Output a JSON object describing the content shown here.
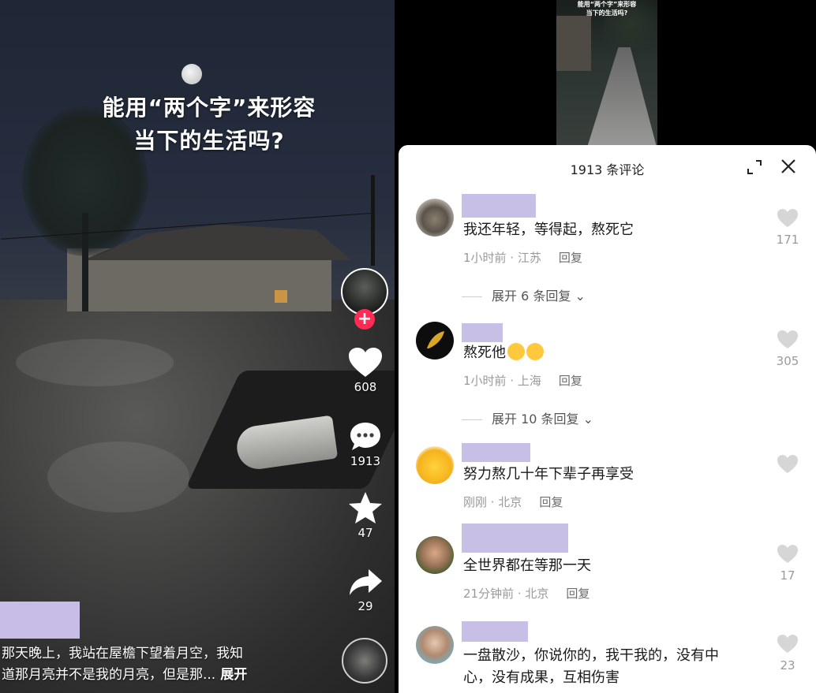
{
  "video": {
    "headline_line1": "能用“两个字”来形容",
    "headline_line2": "当下的生活吗?",
    "caption_line1": "那天晚上，我站在屋檐下望着月空，我知",
    "caption_line2": "道那月亮并不是我的月亮，但是那...",
    "caption_more": "展开",
    "actions": {
      "likes": "608",
      "comments": "1913",
      "favorites": "47",
      "shares": "29"
    },
    "follow_symbol": "+",
    "colors": {
      "follow_button": "#fe2c55"
    }
  },
  "mini_video": {
    "title_line1": "能用“两个字”来形容",
    "title_line2": "当下的生活吗?"
  },
  "comments_sheet": {
    "title": "1913 条评论",
    "colors": {
      "redacted_name": "#c8bfe6"
    },
    "comments": [
      {
        "text": "我还年轻，等得起，熬死它",
        "time": "1小时前 · 江苏",
        "reply": "回复",
        "likes": "171",
        "expand": "展开 6 条回复"
      },
      {
        "text": "熬死他",
        "time": "1小时前 · 上海",
        "reply": "回复",
        "likes": "305",
        "expand": "展开 10 条回复"
      },
      {
        "text": "努力熬几十年下辈子再享受",
        "time": "刚刚 · 北京",
        "reply": "回复",
        "likes": ""
      },
      {
        "text": "全世界都在等那一天",
        "time": "21分钟前 · 北京",
        "reply": "回复",
        "likes": "17"
      },
      {
        "text_line1": "一盘散沙，你说你的，我干我的，没有中",
        "text_line2": "心，没有成果，互相伤害",
        "likes": "23"
      }
    ]
  }
}
